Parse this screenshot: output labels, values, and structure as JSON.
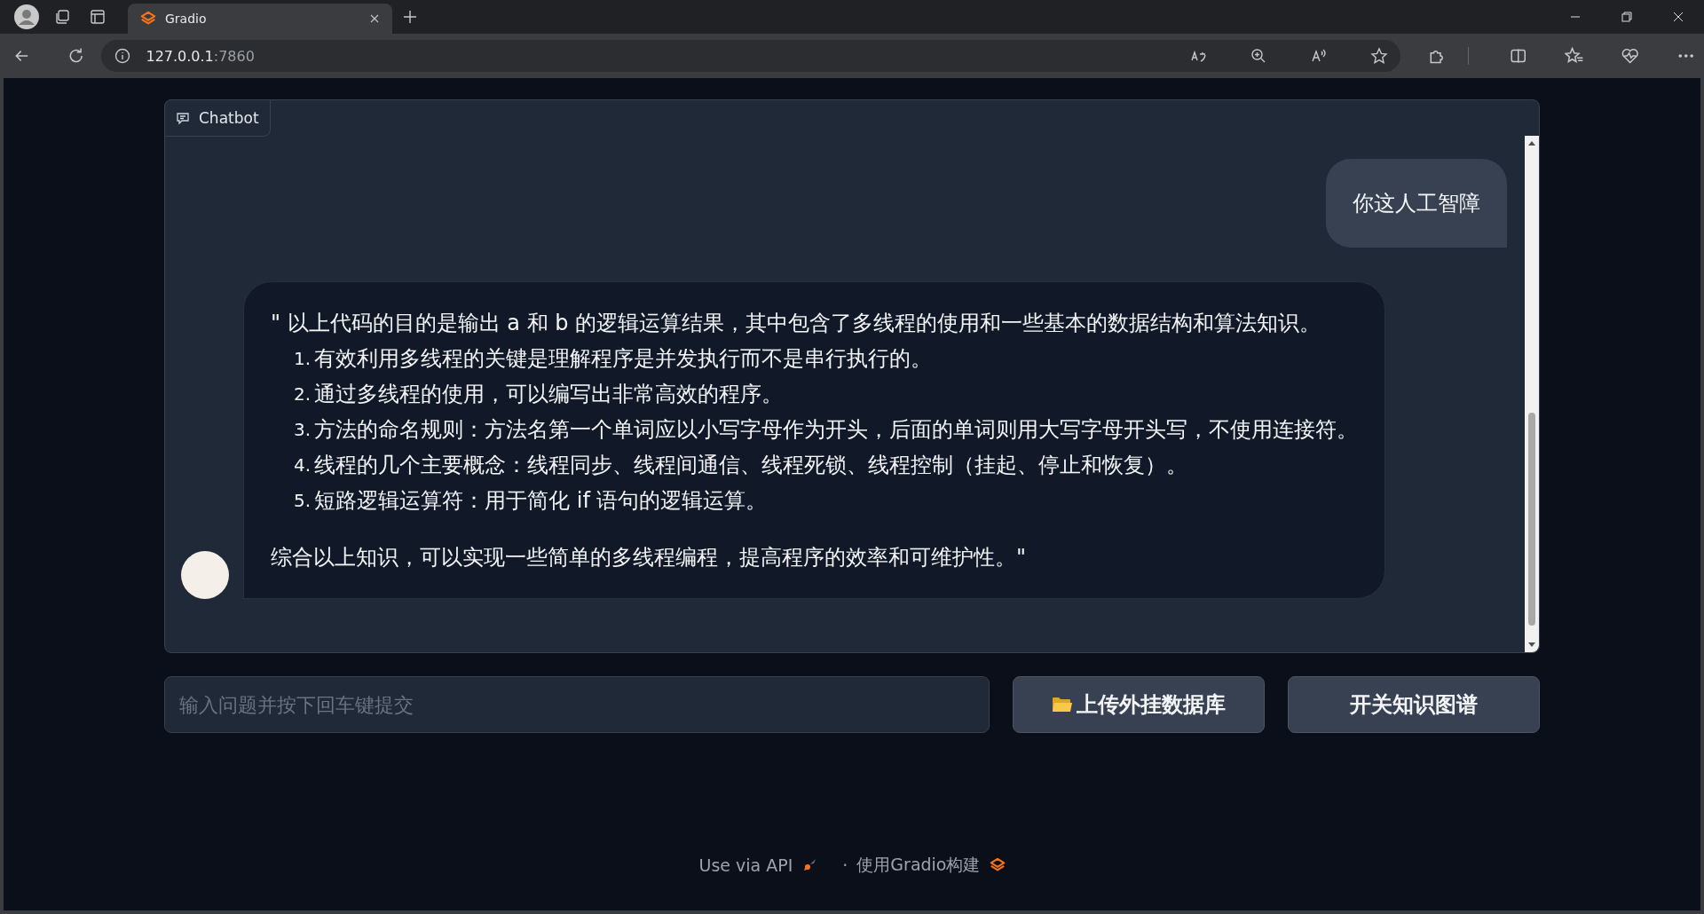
{
  "browser": {
    "tabs": [
      {
        "title": "Gradio",
        "selected": true
      }
    ],
    "address": {
      "host": "127.0.0.1",
      "port": ":7860"
    }
  },
  "chatbot": {
    "label": "Chatbot",
    "messages": [
      {
        "kind": "user",
        "text": "你这人工智障"
      },
      {
        "kind": "bot",
        "intro": "\" 以上代码的目的是输出 a 和 b 的逻辑运算结果，其中包含了多线程的使用和一些基本的数据结构和算法知识。",
        "items": [
          {
            "number": "1.",
            "text": "有效利用多线程的关键是理解程序是并发执行而不是串行执行的。"
          },
          {
            "number": "2.",
            "text": "通过多线程的使用，可以编写出非常高效的程序。"
          },
          {
            "number": "3.",
            "text": "方法的命名规则：方法名第一个单词应以小写字母作为开头，后面的单词则用大写字母开头写，不使用连接符。"
          },
          {
            "number": "4.",
            "text": "线程的几个主要概念：线程同步、线程间通信、线程死锁、线程控制（挂起、停止和恢复）。"
          },
          {
            "number": "5.",
            "text": "短路逻辑运算符：用于简化 if 语句的逻辑运算。"
          }
        ],
        "outro": "综合以上知识，可以实现一些简单的多线程编程，提高程序的效率和可维护性。\""
      }
    ]
  },
  "input": {
    "placeholder": "输入问题并按下回车键提交"
  },
  "buttons": [
    {
      "label": "上传外挂数据库",
      "kind": "folder"
    },
    {
      "label": "开关知识图谱",
      "kind": "plain"
    }
  ],
  "footer": {
    "api_link": "Use via API",
    "separator": "·",
    "built_with": "使用Gradio构建"
  }
}
